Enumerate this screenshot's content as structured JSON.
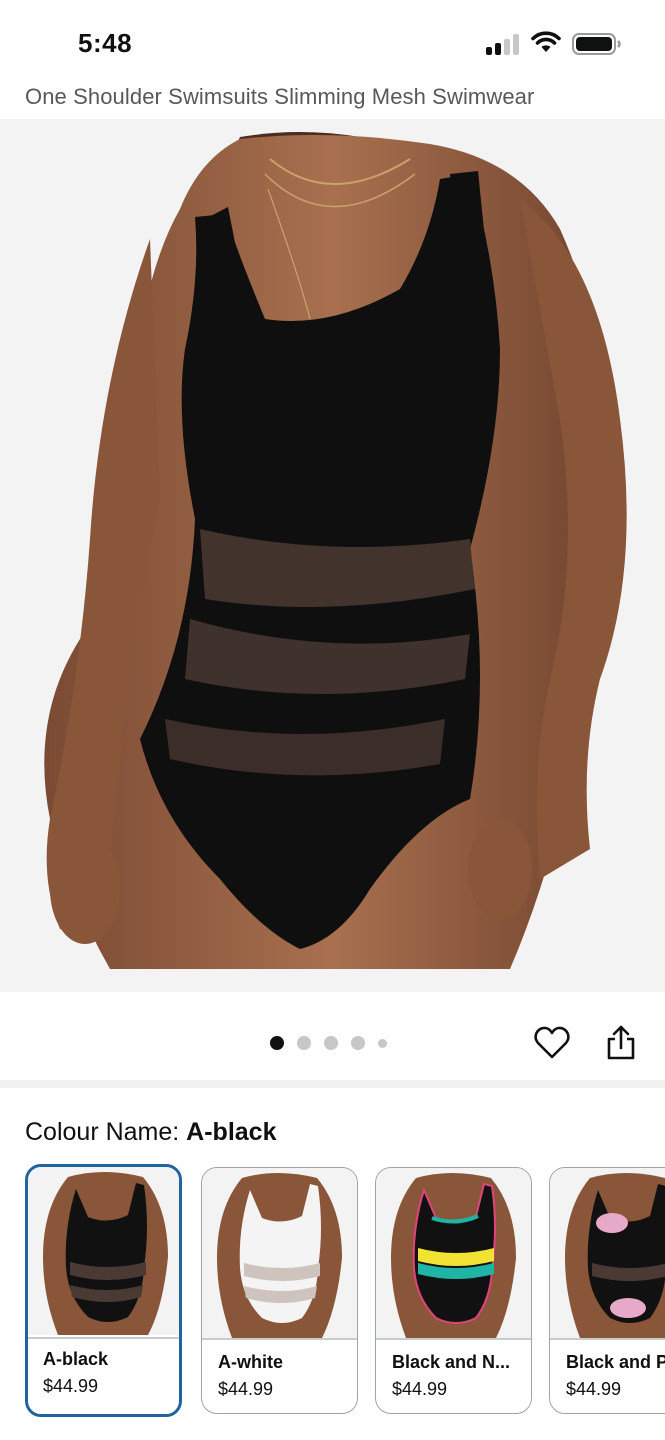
{
  "status_bar": {
    "time": "5:48"
  },
  "product": {
    "title": "One Shoulder Swimsuits Slimming Mesh Swimwear"
  },
  "carousel": {
    "image_count": 5,
    "active_index": 0
  },
  "variation": {
    "label": "Colour Name: ",
    "selected_value": "A-black"
  },
  "swatches": [
    {
      "name": "A-black",
      "price": "$44.99",
      "selected": true
    },
    {
      "name": "A-white",
      "price": "$44.99",
      "selected": false
    },
    {
      "name": "Black and N...",
      "price": "$44.99",
      "selected": false
    },
    {
      "name": "Black and P",
      "price": "$44.99",
      "selected": false
    }
  ],
  "icons": {
    "signal": "cellular-signal-icon",
    "wifi": "wifi-icon",
    "battery": "battery-icon",
    "wishlist": "heart-icon",
    "share": "share-icon"
  },
  "colors": {
    "selected_border": "#2162a1",
    "text_primary": "#0f1111",
    "text_secondary": "#565959",
    "image_background": "#f3f3f3"
  }
}
